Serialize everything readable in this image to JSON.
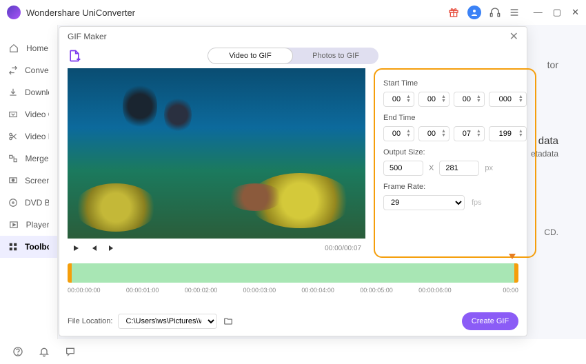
{
  "app": {
    "title": "Wondershare UniConverter"
  },
  "titlebar": {
    "gift": "gift-icon",
    "avatar": "user-avatar",
    "support": "headset-icon",
    "menu": "hamburger-icon"
  },
  "sidebar": {
    "items": [
      {
        "label": "Home",
        "icon": "home-icon"
      },
      {
        "label": "Converter",
        "icon": "convert-icon"
      },
      {
        "label": "Downloader",
        "icon": "download-icon"
      },
      {
        "label": "Video Compressor",
        "icon": "compress-icon"
      },
      {
        "label": "Video Editor",
        "icon": "scissors-icon"
      },
      {
        "label": "Merger",
        "icon": "merge-icon"
      },
      {
        "label": "Screen Recorder",
        "icon": "record-icon"
      },
      {
        "label": "DVD Burner",
        "icon": "disc-icon"
      },
      {
        "label": "Player",
        "icon": "player-icon"
      },
      {
        "label": "Toolbox",
        "icon": "grid-icon"
      }
    ],
    "active_index": 9
  },
  "main_stray": {
    "s1": "tor",
    "s2": "data",
    "s3": "etadata",
    "s4": "CD."
  },
  "dialog": {
    "title": "GIF Maker",
    "tabs": {
      "video": "Video to GIF",
      "photos": "Photos to GIF",
      "active": "video"
    },
    "start_time_label": "Start Time",
    "end_time_label": "End Time",
    "start_time": {
      "h": "00",
      "m": "00",
      "s": "00",
      "ms": "000"
    },
    "end_time": {
      "h": "00",
      "m": "00",
      "s": "07",
      "ms": "199"
    },
    "output_size_label": "Output Size:",
    "output_size": {
      "w": "500",
      "h": "281",
      "unit": "px"
    },
    "frame_rate_label": "Frame Rate:",
    "frame_rate": "29",
    "fps_unit": "fps",
    "playback_time": "00:00/00:07",
    "timeline_ticks": [
      "00:00:00:00",
      "00:00:01:00",
      "00:00:02:00",
      "00:00:03:00",
      "00:00:04:00",
      "00:00:05:00",
      "00:00:06:00",
      "00:00"
    ],
    "file_location_label": "File Location:",
    "file_location": "C:\\Users\\ws\\Pictures\\Wonders",
    "create_label": "Create GIF"
  },
  "bottombar": {
    "help": "help",
    "notify": "bell",
    "chat": "chat"
  },
  "colors": {
    "accent": "#8b5cf6",
    "highlight": "#f59e0b",
    "timeline": "#a8e6b4"
  }
}
